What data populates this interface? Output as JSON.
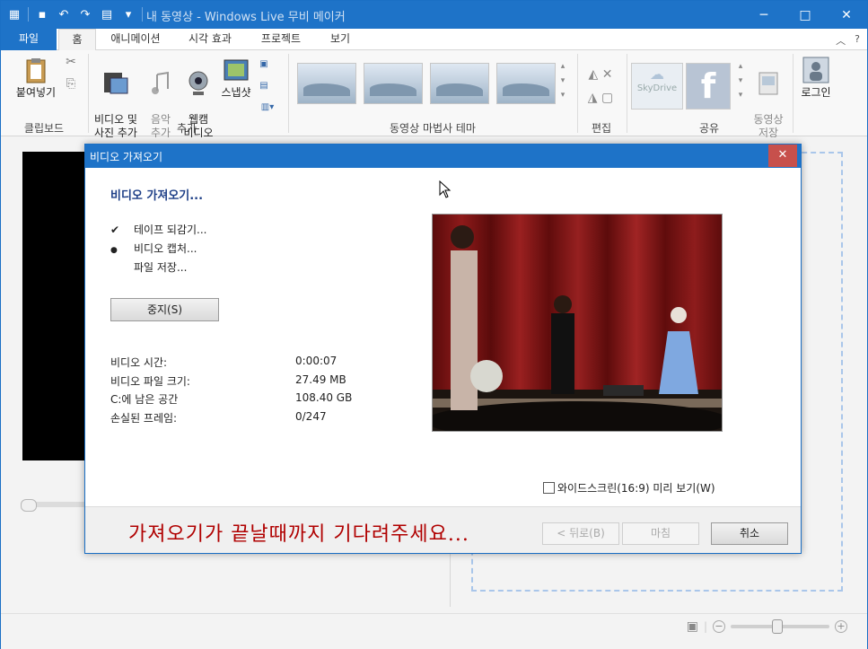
{
  "window": {
    "title": "내 동영상 - Windows Live 무비 메이커",
    "controls": [
      "─",
      "□",
      "✕"
    ]
  },
  "tabs": {
    "file": "파일",
    "items": [
      "홈",
      "애니메이션",
      "시각 효과",
      "프로젝트",
      "보기"
    ]
  },
  "ribbon": {
    "paste_label": "붙여넣기",
    "clipboard_group": "클립보드",
    "add_video_label": "비디오 및\n사진 추가",
    "music_label": "음악\n추가",
    "webcam_label": "웹캠\n비디오",
    "snapshot_label": "스냅샷",
    "add_group": "추가",
    "theme_group": "동영상 마법사 테마",
    "edit_group": "편집",
    "skydrive_label": "SkyDrive",
    "save_movie_label": "동영상\n저장",
    "share_group": "공유",
    "login_label": "로그인"
  },
  "dialog": {
    "title": "비디오 가져오기",
    "close": "✕",
    "heading": "비디오 가져오기...",
    "steps": [
      {
        "mark": "✔",
        "label": "테이프 되감기..."
      },
      {
        "mark": "●",
        "label": "비디오 캡처..."
      },
      {
        "mark": "",
        "label": "파일 저장..."
      }
    ],
    "stop_button": "중지(S)",
    "stats": [
      {
        "label": "비디오 시간:",
        "value": "0:00:07"
      },
      {
        "label": "비디오 파일 크기:",
        "value": "27.49 MB"
      },
      {
        "label": "C:에 남은 공간",
        "value": "108.40 GB"
      },
      {
        "label": "손실된 프레임:",
        "value": "0/247"
      }
    ],
    "widescreen_label": "와이드스크린(16:9) 미리 보기(W)",
    "overlay_message": "가져오기가 끝날때까지 기다려주세요...",
    "back_button": "< 뒤로(B)",
    "finish_button": "마침",
    "cancel_button": "취소"
  },
  "colors": {
    "titlebar": "#1e73c8",
    "close_red": "#c7504c",
    "heading_blue": "#1e3f87",
    "overlay_text": "#b00000"
  }
}
